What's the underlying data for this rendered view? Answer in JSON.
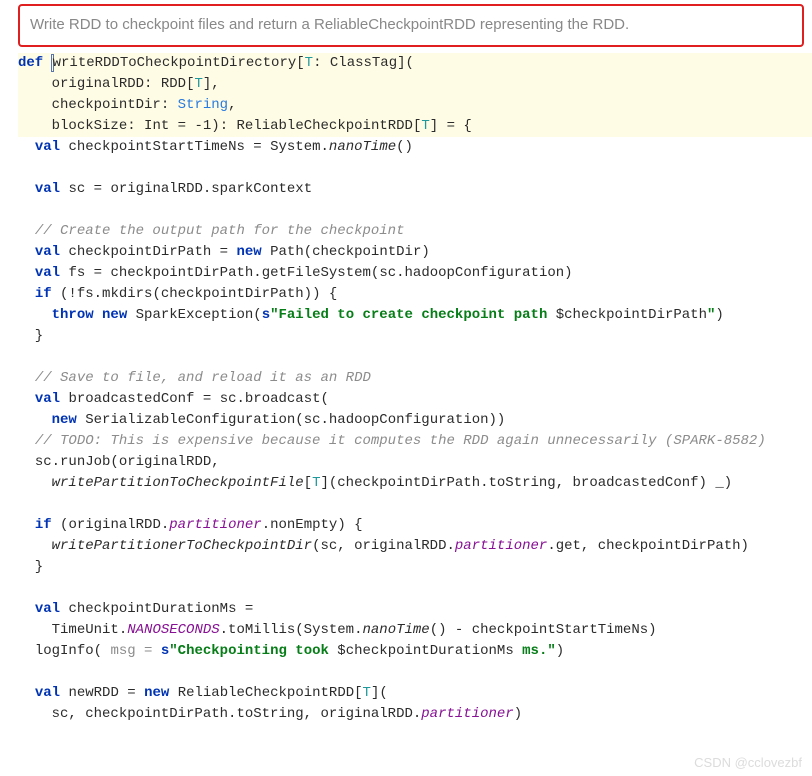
{
  "doc": {
    "text": "Write RDD to checkpoint files and return a ReliableCheckpointRDD representing the RDD."
  },
  "code": {
    "def": "def",
    "fn": "writeRDDToCheckpointDirectory",
    "tparam": "T",
    "classTag": "ClassTag",
    "p1_name": "originalRDD",
    "p1_type": "RDD",
    "p2_name": "checkpointDir",
    "p2_type": "String",
    "p3_name": "blockSize",
    "p3_type": "Int",
    "p3_default": "-1",
    "ret_type": "ReliableCheckpointRDD",
    "l1_val": "val",
    "l1_name": "checkpointStartTimeNs",
    "l1_rhs1": "System",
    "l1_rhs2": "nanoTime",
    "l2_name": "sc",
    "l2_rhs": "originalRDD.sparkContext",
    "c1": "// Create the output path for the checkpoint",
    "l3_name": "checkpointDirPath",
    "l3_new": "new",
    "l3_type": "Path",
    "l3_arg": "checkpointDir",
    "l4_name": "fs",
    "l4_rhs": "checkpointDirPath.getFileSystem(sc.hadoopConfiguration)",
    "if1_cond": "(!fs.mkdirs(checkpointDirPath))",
    "throw": "throw",
    "new": "new",
    "exc_type": "SparkException",
    "s_prefix": "s",
    "exc_msg1": "\"Failed to create checkpoint path ",
    "exc_var": "$checkpointDirPath",
    "exc_msg2": "\"",
    "c2": "// Save to file, and reload it as an RDD",
    "l5_name": "broadcastedConf",
    "l5_rhs": "sc.broadcast(",
    "l5_type": "SerializableConfiguration",
    "l5_arg": "sc.hadoopConfiguration",
    "c3": "// TODO: This is expensive because it computes the RDD again unnecessarily (SPARK-8582)",
    "l6_call": "sc.runJob(originalRDD,",
    "l6_fn": "writePartitionToCheckpointFile",
    "l6_args": "(checkpointDirPath.toString, broadcastedConf) _)",
    "if2_lhs": "originalRDD",
    "if2_field": "partitioner",
    "if2_method": "nonEmpty",
    "l7_fn": "writePartitionerToCheckpointDir",
    "l7_arg1": "sc, originalRDD",
    "l7_arg2": ".get, checkpointDirPath)",
    "l8_name": "checkpointDurationMs",
    "l8_type": "TimeUnit",
    "l8_field": "NANOSECONDS",
    "l8_rhs": ".toMillis(System.",
    "l8_nano": "nanoTime",
    "l8_end": "() - checkpointStartTimeNs)",
    "log_fn": "logInfo",
    "log_hint": "msg = ",
    "log_msg1": "\"Checkpointing took ",
    "log_var": "$checkpointDurationMs",
    "log_msg2": " ms.\"",
    "l9_name": "newRDD",
    "l9_type": "ReliableCheckpointRDD",
    "l9_args1": "sc, checkpointDirPath.toString, originalRDD",
    "l9_field": "partitioner"
  },
  "watermark": "CSDN @cclovezbf"
}
